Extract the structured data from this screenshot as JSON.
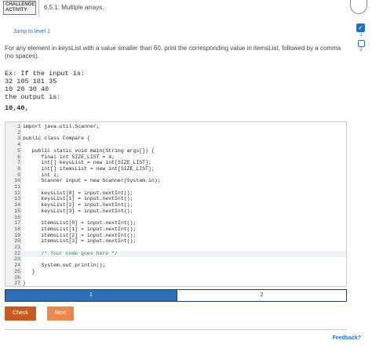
{
  "header": {
    "badge_line1": "CHALLENGE",
    "badge_line2": "ACTIVITY",
    "title": "6.5.1: Multiple arrays."
  },
  "side": {
    "level1": "1",
    "level2": "2"
  },
  "jump_link": "Jump to level 1",
  "instructions": "For any element in keysList with a value smaller than 60, print the corresponding value in itemsList, followed by a comma (no spaces).",
  "sample": {
    "intro": "Ex: If the input is:",
    "line1": "32 105 101 35",
    "line2": "10 20 30 40",
    "outro": "the output is:",
    "output": "10,40,"
  },
  "code_lines": [
    {
      "n": "1",
      "t": "import java.util.Scanner;"
    },
    {
      "n": "2",
      "t": ""
    },
    {
      "n": "3",
      "t": "public class Compare {"
    },
    {
      "n": "4",
      "t": ""
    },
    {
      "n": "5",
      "t": "   public static void main(String args[]) {"
    },
    {
      "n": "6",
      "t": "      final int SIZE_LIST = 4;"
    },
    {
      "n": "7",
      "t": "      int[] keysList = new int[SIZE_LIST];"
    },
    {
      "n": "8",
      "t": "      int[] itemsList = new int[SIZE_LIST];"
    },
    {
      "n": "9",
      "t": "      int i;"
    },
    {
      "n": "10",
      "t": "      Scanner input = new Scanner(System.in);"
    },
    {
      "n": "11",
      "t": ""
    },
    {
      "n": "12",
      "t": "      keysList[0] = input.nextInt();"
    },
    {
      "n": "13",
      "t": "      keysList[1] = input.nextInt();"
    },
    {
      "n": "14",
      "t": "      keysList[2] = input.nextInt();"
    },
    {
      "n": "15",
      "t": "      keysList[3] = input.nextInt();"
    },
    {
      "n": "16",
      "t": ""
    },
    {
      "n": "17",
      "t": "      itemsList[0] = input.nextInt();"
    },
    {
      "n": "18",
      "t": "      itemsList[1] = input.nextInt();"
    },
    {
      "n": "19",
      "t": "      itemsList[2] = input.nextInt();"
    },
    {
      "n": "20",
      "t": "      itemsList[3] = input.nextInt();"
    },
    {
      "n": "21",
      "t": ""
    },
    {
      "n": "22",
      "t": "      /* Your code goes here */"
    },
    {
      "n": "23",
      "t": ""
    },
    {
      "n": "24",
      "t": "      System.out.println();"
    },
    {
      "n": "25",
      "t": "   }"
    },
    {
      "n": "26",
      "t": ""
    },
    {
      "n": "27",
      "t": "}"
    }
  ],
  "progress": {
    "seg1_label": "1",
    "seg2_label": "2"
  },
  "buttons": {
    "check": "Check",
    "next": "Next"
  },
  "feedback": "Feedback?",
  "colors": {
    "accent": "#1e73c8",
    "check_button": "#c75a1c",
    "next_button": "#e8884a",
    "progress_fill": "#2d6eb8"
  }
}
